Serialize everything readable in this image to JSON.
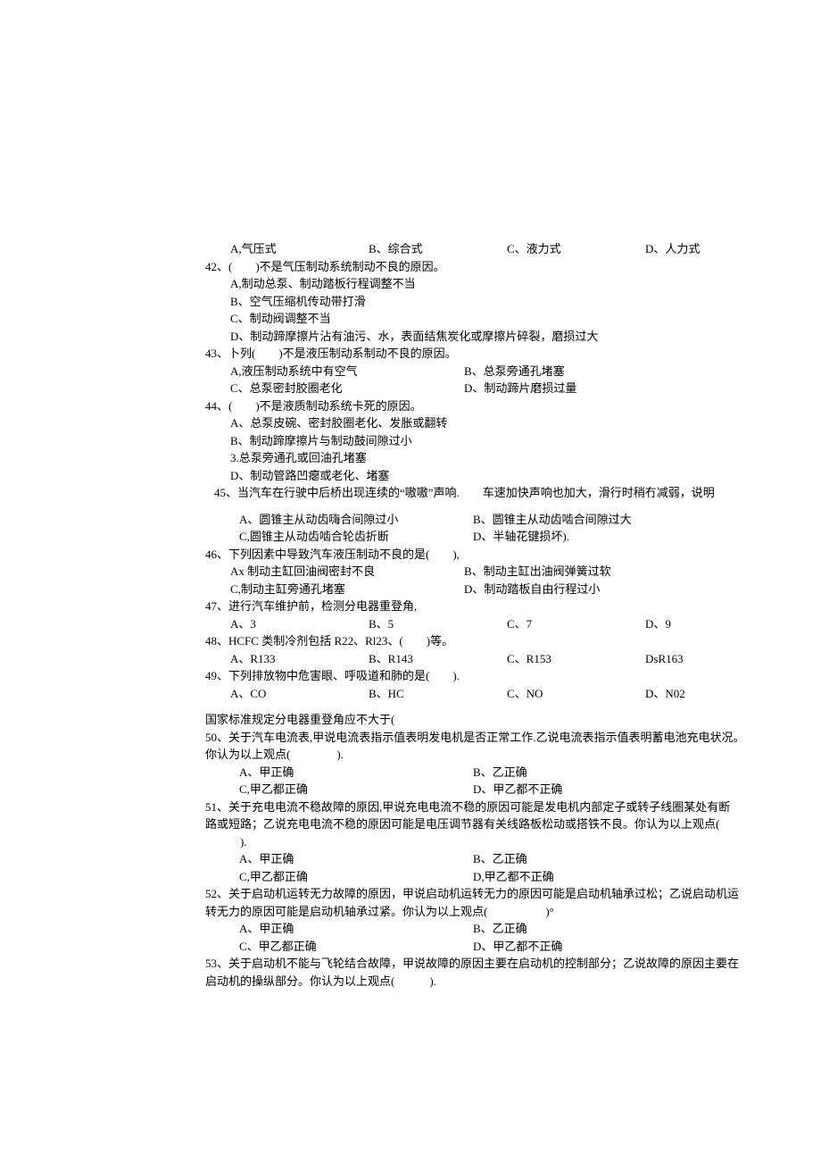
{
  "l1": {
    "a": "A,气压式",
    "b": "B、综合式",
    "c": "C、液力式",
    "d": "D、人力式"
  },
  "q42": "42、(  )不是气压制动系统制动不良的原因。",
  "q42a": "A,制动总泵、制动踏板行程调整不当",
  "q42b": "B、空气压缩机传动带打滑",
  "q42c": "C、制动阀调整不当",
  "q42d": "D、制动蹄摩擦片沾有油污、水，表面结焦炭化或摩擦片碎裂，磨损过大",
  "q43": "43、卜列(  )不是液压制动系制动不良的原因。",
  "q43a": "A,液压制动系统中有空气",
  "q43b": "B、总泵旁通孔堵塞",
  "q43c": "C、总泵密封胶圈老化",
  "q43d": "D、制动蹄片磨损过量",
  "q44": "44、(  )不是液质制动系统卡死的原因。",
  "q44a": "A、总泵皮碗、密封胶圈老化、发胀或翻转",
  "q44b": "B、制动蹄摩擦片与制动鼓间隙过小",
  "q44c": "3.总泵旁通孔或回油孔堵塞",
  "q44d": "D、制动管路凹瘪或老化、堵塞",
  "q45": "45、当汽车在行驶中后桥出现连续的“嗷嗷”声响.  车速加快声响也加大，滑行时稍冇减弱，说明",
  "q45a": "A、圆锥主从动齿嗨合间隙过小",
  "q45b": "B、圆锥主从动齿啮合间隙过大",
  "q45c": "C,圆锥主从动齿啮合轮齿折断",
  "q45d": "D、半轴花键损坏).",
  "q46": "46、下列因素中导致汽车液压制动不良的是(  ),",
  "q46a": "Ax 制动主缸回油阀密封不良",
  "q46b": "B、制动主缸出油阀弹簧过软",
  "q46c": "C,制动主缸旁通孔堵塞",
  "q46d": "D、制动踏板自由行程过小",
  "q47": "47、进行汽车维护前，检测分电器重登角,",
  "l47": {
    "a": "A、3",
    "b": "B、5",
    "c": "C、7",
    "d": "D、9"
  },
  "q48": "48、HCFC 类制冷剂包括 R22、Rl23、(  )等。",
  "l48": {
    "a": "A、R133",
    "b": "B、R143",
    "c": "C、R153",
    "d": "DsR163"
  },
  "q49": "49、下列排放物中危害眼、呼吸道和肺的是(  ).",
  "l49": {
    "a": "A、CO",
    "b": "B、HC",
    "c": "C、NO",
    "d": "D、N02"
  },
  "s50a": "国家标准规定分电器重登角应不大于(",
  "s50b": "50、关于汽车电流表,甲说电流表指示值表明发电机是否正常工作.乙说电流表指示值表明蓄电池充电状况。",
  "s50c": "你认为以上观点(    ).",
  "o50a": "A、甲正确",
  "o50b": "B、乙正确",
  "o50c": "C,甲乙都正确",
  "o50d": "D、甲乙都不正确",
  "q51a": "51、关于充电电流不稳故障的原因,甲说充电电流不稳的原因可能是发电机内部定子或转子线圈某处有断",
  "q51b": "路或短路；乙说充电电流不稳的原因可能是电压调节器有关线路板松动或搭铁不良。你认为以上观点(",
  "q51c": "   ).",
  "o51a": "A、甲正确",
  "o51b": "B、乙正确",
  "o51c": "C,甲乙都正确",
  "o51d": "D,甲乙都不正确",
  "q52a": "52、关于启动机运转无力故障的原因，甲说启动机运转无力的原因可能是启动机轴承过松；乙说启动机运",
  "q52b": "转无力的原因可能是启动机轴承过紧。你认为以上观点(     )°",
  "o52a": "A、甲正确",
  "o52b": "B、乙正确",
  "o52c": "C、甲乙都正确",
  "o52d": "D、甲乙都不正确",
  "q53a": "53、关于启动机不能与飞轮结合故障，甲说故障的原因主要在启动机的控制部分；乙说故障的原因主要在",
  "q53b": "启动机的操纵部分。你认为以上观点(   )."
}
